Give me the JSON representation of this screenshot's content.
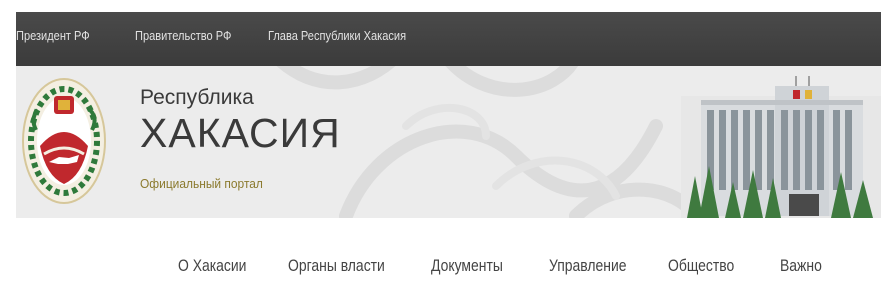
{
  "topbar": {
    "links": [
      {
        "label": "Президент РФ"
      },
      {
        "label": "Правительство РФ"
      },
      {
        "label": "Глава Республики Хакасия"
      }
    ]
  },
  "header": {
    "title_small": "Республика",
    "title_big": "ХАКАСИЯ",
    "subtitle": "Официальный портал"
  },
  "nav": {
    "items": [
      {
        "label": "О Хакасии"
      },
      {
        "label": "Органы власти"
      },
      {
        "label": "Документы"
      },
      {
        "label": "Управление"
      },
      {
        "label": "Общество"
      },
      {
        "label": "Важно"
      }
    ]
  },
  "colors": {
    "topbar_bg": "#3f3f3f",
    "header_bg": "#ececec",
    "subtitle": "#8b7a2e",
    "emblem_red": "#c0282d",
    "emblem_green": "#2f7a3b"
  }
}
